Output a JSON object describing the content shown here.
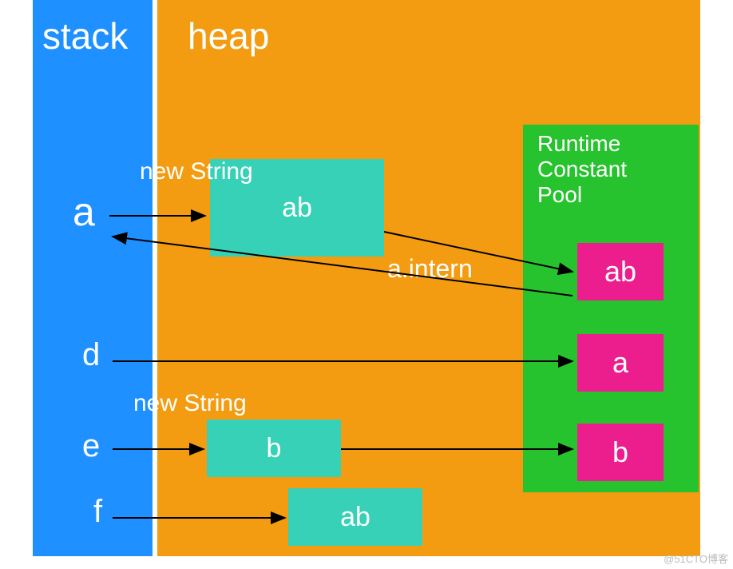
{
  "regions": {
    "stack_header": "stack",
    "heap_header": "heap",
    "rcp_title": "Runtime\nConstant\nPool"
  },
  "labels": {
    "new_string_1": "new String",
    "new_string_2": "new String",
    "a_intern": "a.intern"
  },
  "heap_objects": {
    "obj_ab": "ab",
    "obj_b": "b",
    "obj_ab2": "ab"
  },
  "pool_entries": {
    "pool_ab": "ab",
    "pool_a": "a",
    "pool_b": "b"
  },
  "stack_vars": {
    "a": "a",
    "d": "d",
    "e": "e",
    "f": "f"
  },
  "watermark": "@51CTO博客"
}
